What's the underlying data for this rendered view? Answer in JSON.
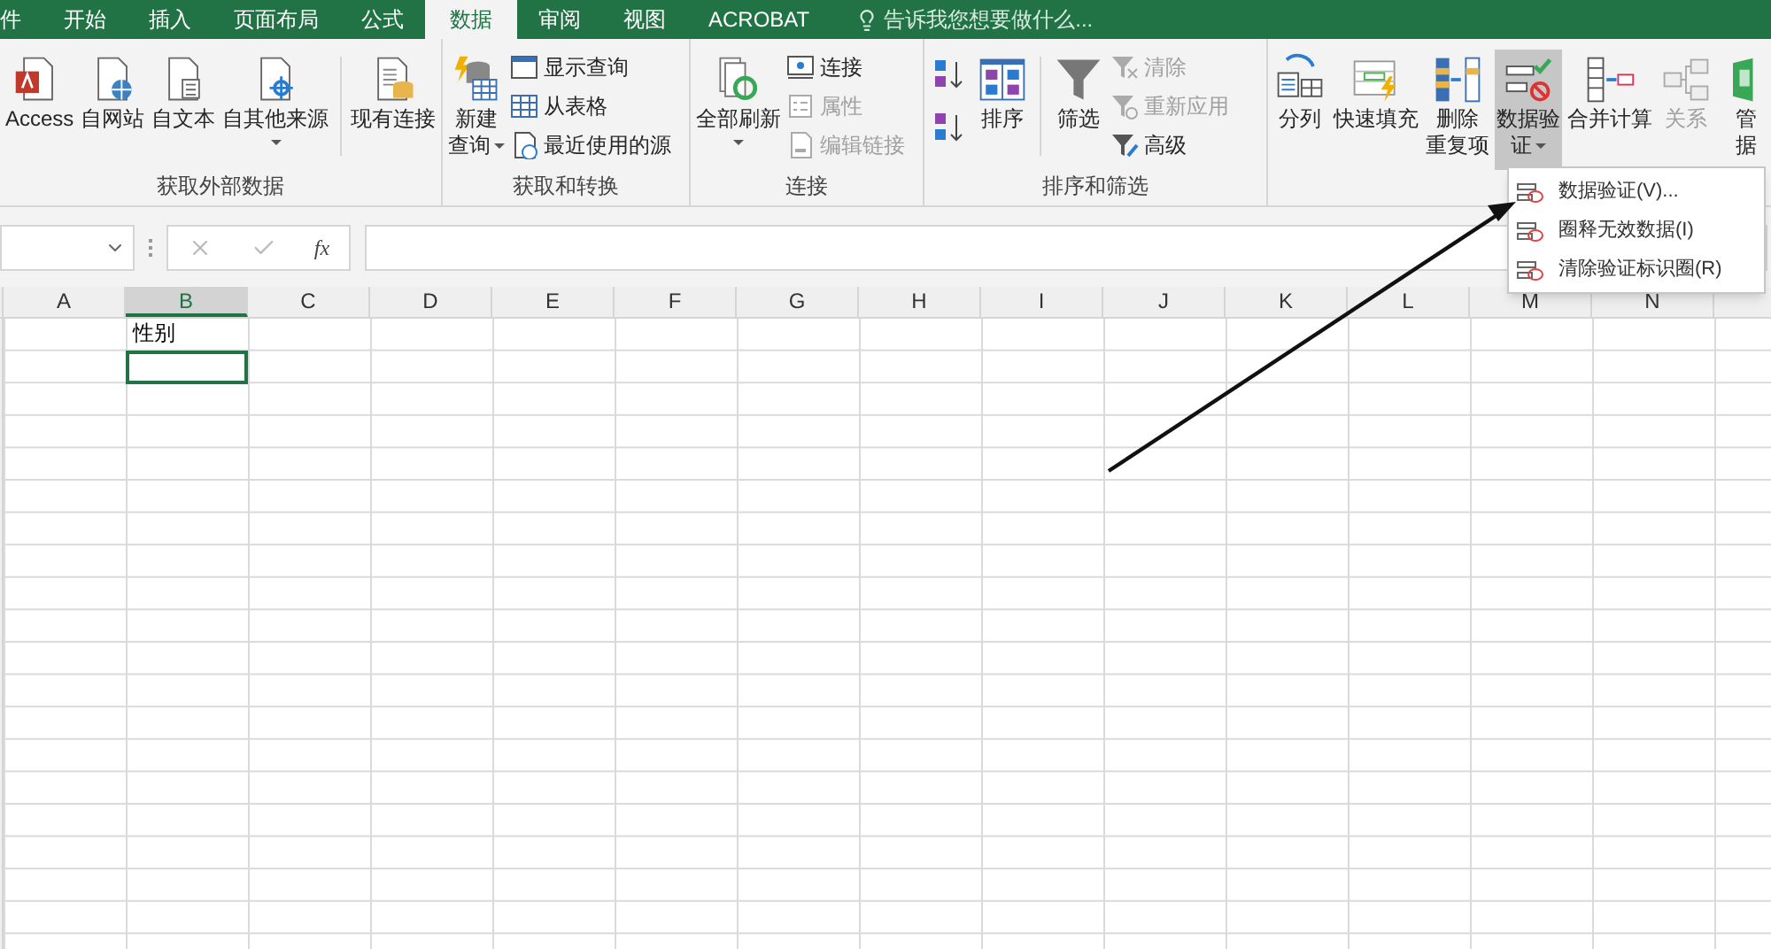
{
  "tabs": [
    {
      "label": "件",
      "selected": false
    },
    {
      "label": "开始",
      "selected": false
    },
    {
      "label": "插入",
      "selected": false
    },
    {
      "label": "页面布局",
      "selected": false
    },
    {
      "label": "公式",
      "selected": false
    },
    {
      "label": "数据",
      "selected": true
    },
    {
      "label": "审阅",
      "selected": false
    },
    {
      "label": "视图",
      "selected": false
    },
    {
      "label": "ACROBAT",
      "selected": false
    }
  ],
  "tell_me": {
    "placeholder": "告诉我您想要做什么..."
  },
  "ribbon": {
    "groups": [
      {
        "label": "获取外部数据",
        "items": [
          {
            "kind": "large",
            "lines": [
              "Access"
            ],
            "dropdown": false,
            "selected": false,
            "disabled": false
          },
          {
            "kind": "large",
            "lines": [
              "自网站"
            ],
            "dropdown": false,
            "selected": false,
            "disabled": false
          },
          {
            "kind": "large",
            "lines": [
              "自文本"
            ],
            "dropdown": false,
            "selected": false,
            "disabled": false
          },
          {
            "kind": "large",
            "lines": [
              "自其他来源"
            ],
            "dropdown": true,
            "selected": false,
            "disabled": false
          },
          {
            "kind": "separator"
          },
          {
            "kind": "large",
            "lines": [
              "现有连接"
            ],
            "dropdown": false,
            "selected": false,
            "disabled": false
          }
        ]
      },
      {
        "label": "获取和转换",
        "items": [
          {
            "kind": "large",
            "lines": [
              "新建",
              "查询"
            ],
            "dropdown": true,
            "selected": false,
            "disabled": false
          },
          {
            "kind": "stack",
            "items": [
              {
                "label": "显示查询",
                "disabled": false
              },
              {
                "label": "从表格",
                "disabled": false
              },
              {
                "label": "最近使用的源",
                "disabled": false
              }
            ]
          }
        ]
      },
      {
        "label": "连接",
        "items": [
          {
            "kind": "large",
            "lines": [
              "全部刷新"
            ],
            "dropdown": true,
            "selected": false,
            "disabled": false
          },
          {
            "kind": "stack",
            "items": [
              {
                "label": "连接",
                "disabled": false
              },
              {
                "label": "属性",
                "disabled": true
              },
              {
                "label": "编辑链接",
                "disabled": true
              }
            ]
          }
        ]
      },
      {
        "label": "排序和筛选",
        "items": [
          {
            "kind": "sort_buttons"
          },
          {
            "kind": "large",
            "lines": [
              "排序"
            ],
            "dropdown": false,
            "selected": false,
            "disabled": false
          },
          {
            "kind": "separator"
          },
          {
            "kind": "large",
            "lines": [
              "筛选"
            ],
            "dropdown": false,
            "selected": false,
            "disabled": false
          },
          {
            "kind": "stack",
            "items": [
              {
                "label": "清除",
                "disabled": true
              },
              {
                "label": "重新应用",
                "disabled": true
              },
              {
                "label": "高级",
                "disabled": false
              }
            ]
          }
        ]
      },
      {
        "items": [
          {
            "kind": "large",
            "lines": [
              "分列"
            ],
            "dropdown": false,
            "selected": false,
            "disabled": false
          },
          {
            "kind": "large",
            "lines": [
              "快速填充"
            ],
            "dropdown": false,
            "selected": false,
            "disabled": false
          },
          {
            "kind": "large",
            "lines": [
              "删除",
              "重复项"
            ],
            "dropdown": false,
            "selected": false,
            "disabled": false
          },
          {
            "kind": "large",
            "lines": [
              "数据验",
              "证"
            ],
            "dropdown": true,
            "selected": true,
            "disabled": false
          },
          {
            "kind": "large",
            "lines": [
              "合并计算"
            ],
            "dropdown": false,
            "selected": false,
            "disabled": false
          },
          {
            "kind": "large",
            "lines": [
              "关系"
            ],
            "dropdown": false,
            "selected": false,
            "disabled": true
          },
          {
            "kind": "large",
            "lines": [
              "管",
              "据"
            ],
            "dropdown": false,
            "selected": false,
            "disabled": false
          }
        ]
      }
    ]
  },
  "formula_bar": {
    "function_label": "fx"
  },
  "columns": [
    {
      "label": "A",
      "selected": false
    },
    {
      "label": "B",
      "selected": true,
      "cells": [
        {
          "text": "性别",
          "selected": false
        },
        {
          "selected": true
        }
      ]
    },
    {
      "label": "C",
      "selected": false
    },
    {
      "label": "D",
      "selected": false
    },
    {
      "label": "E",
      "selected": false
    },
    {
      "label": "F",
      "selected": false
    },
    {
      "label": "G",
      "selected": false
    },
    {
      "label": "H",
      "selected": false
    },
    {
      "label": "I",
      "selected": false
    },
    {
      "label": "J",
      "selected": false
    },
    {
      "label": "K",
      "selected": false
    },
    {
      "label": "L",
      "selected": false
    },
    {
      "label": "M",
      "selected": false
    },
    {
      "label": "N",
      "selected": false
    }
  ],
  "menu": {
    "items": [
      {
        "label": "数据验证(V)..."
      },
      {
        "label": "圈释无效数据(I)"
      },
      {
        "label": "清除验证标识圈(R)"
      }
    ]
  }
}
